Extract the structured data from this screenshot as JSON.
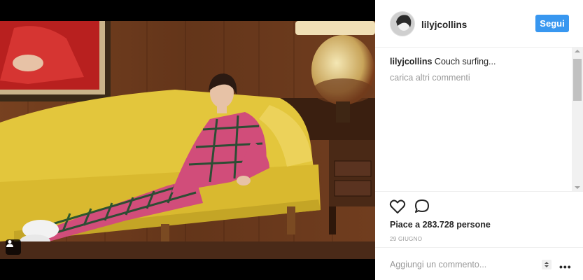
{
  "post": {
    "username": "lilyjcollins",
    "follow_label": "Segui",
    "caption_user": "lilyjcollins",
    "caption_text": " Couch surfing...",
    "load_more_label": "carica altri commenti",
    "likes_text": "Piace a 283.728 persone",
    "date": "29 GIUGNO",
    "add_comment_placeholder": "Aggiungi un commento..."
  },
  "icons": {
    "heart": "heart-icon",
    "comment": "comment-icon",
    "tag": "user-tag-icon",
    "more": "more-options-icon"
  },
  "colors": {
    "accent": "#3897f0",
    "sofa": "#e3c63c",
    "wood": "#6b3a1f"
  }
}
